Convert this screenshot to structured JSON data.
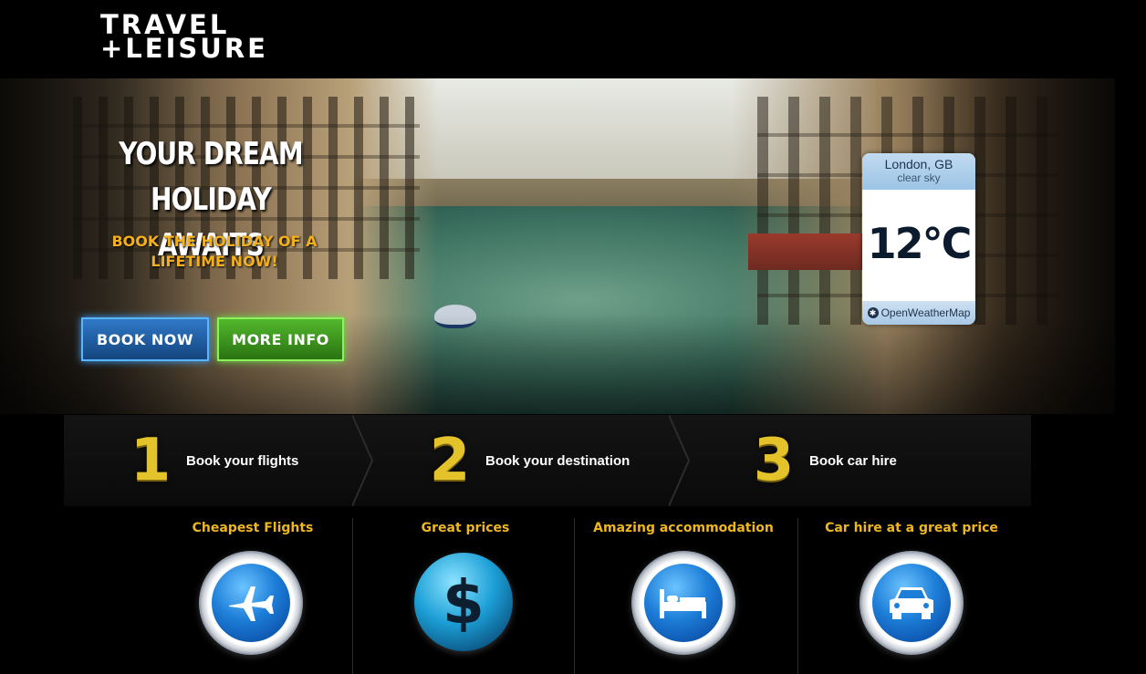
{
  "header": {
    "logo_line1": "TRAVEL",
    "logo_line2": "+LEISURE"
  },
  "hero": {
    "headline_line1": "YOUR DREAM HOLIDAY",
    "headline_line2": "AWAITS",
    "subheadline_line1": "BOOK THE HOLIDAY OF A",
    "subheadline_line2": "LIFETIME NOW!",
    "book_button": "BOOK NOW",
    "info_button": "MORE INFO"
  },
  "weather": {
    "city": "London, GB",
    "condition": "clear sky",
    "temperature": "12°C",
    "provider": "OpenWeatherMap"
  },
  "steps": [
    {
      "number": "1",
      "label": "Book your flights"
    },
    {
      "number": "2",
      "label": "Book your destination"
    },
    {
      "number": "3",
      "label": "Book car hire"
    }
  ],
  "features": [
    {
      "title": "Cheapest Flights",
      "icon": "airplane-icon"
    },
    {
      "title": "Great prices",
      "icon": "dollar-icon"
    },
    {
      "title": "Amazing accommodation",
      "icon": "bed-icon"
    },
    {
      "title": "Car hire at a great price",
      "icon": "car-icon"
    }
  ],
  "colors": {
    "accent_gold": "#efb71f",
    "book_blue": "#2f79c7",
    "info_green": "#52b82c",
    "background": "#000000"
  }
}
